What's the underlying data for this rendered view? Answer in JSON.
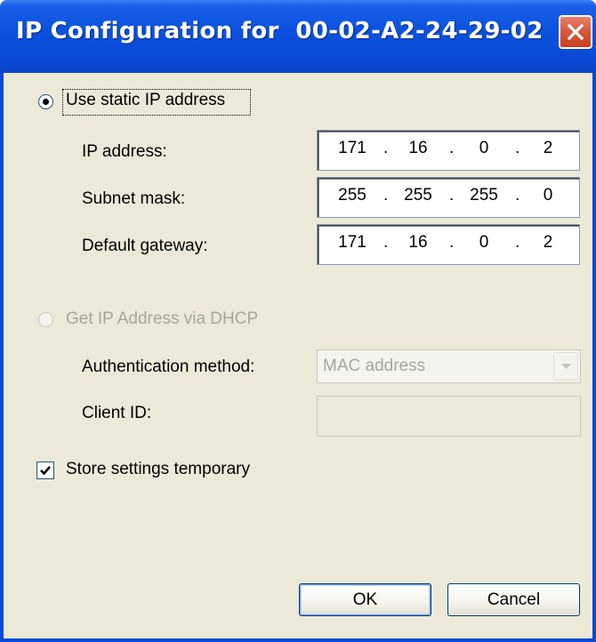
{
  "window": {
    "title": "IP Configuration for  00-02-A2-24-29-02",
    "close_icon": "close-icon"
  },
  "static": {
    "radio_label": "Use static IP address",
    "selected": true,
    "ip_label": "IP address:",
    "ip": [
      "171",
      "16",
      "0",
      "2"
    ],
    "subnet_label": "Subnet mask:",
    "subnet": [
      "255",
      "255",
      "255",
      "0"
    ],
    "gateway_label": "Default gateway:",
    "gateway": [
      "171",
      "16",
      "0",
      "2"
    ]
  },
  "dhcp": {
    "radio_label": "Get IP Address via DHCP",
    "enabled": false,
    "auth_label": "Authentication method:",
    "auth_value": "MAC address",
    "client_id_label": "Client ID:",
    "client_id_value": ""
  },
  "store": {
    "label": "Store settings temporary",
    "checked": true
  },
  "buttons": {
    "ok": "OK",
    "cancel": "Cancel"
  },
  "colors": {
    "title_bar": "#0a52df",
    "client_bg": "#ece9d8",
    "disabled_text": "#a8a797"
  }
}
